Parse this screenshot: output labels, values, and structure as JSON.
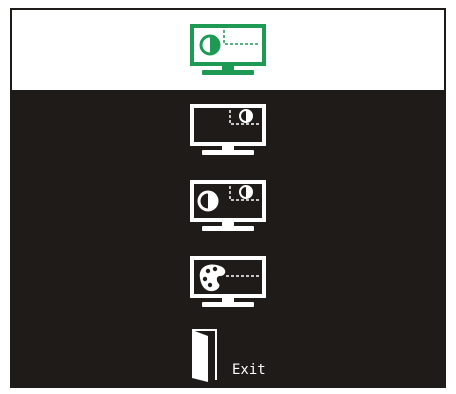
{
  "colors": {
    "frame_bg": "#1e1b19",
    "selected_bg": "#ffffff",
    "selected_icon": "#1f9a55",
    "icon": "#ffffff"
  },
  "menu": {
    "items": [
      {
        "icon": "monitor-pip-picture-icon",
        "selected": true
      },
      {
        "icon": "monitor-subwindow-picture-icon",
        "selected": false
      },
      {
        "icon": "monitor-dual-picture-icon",
        "selected": false
      },
      {
        "icon": "monitor-color-palette-icon",
        "selected": false
      },
      {
        "icon": "exit-door-icon",
        "selected": false
      }
    ],
    "exit_label": "Exit"
  }
}
